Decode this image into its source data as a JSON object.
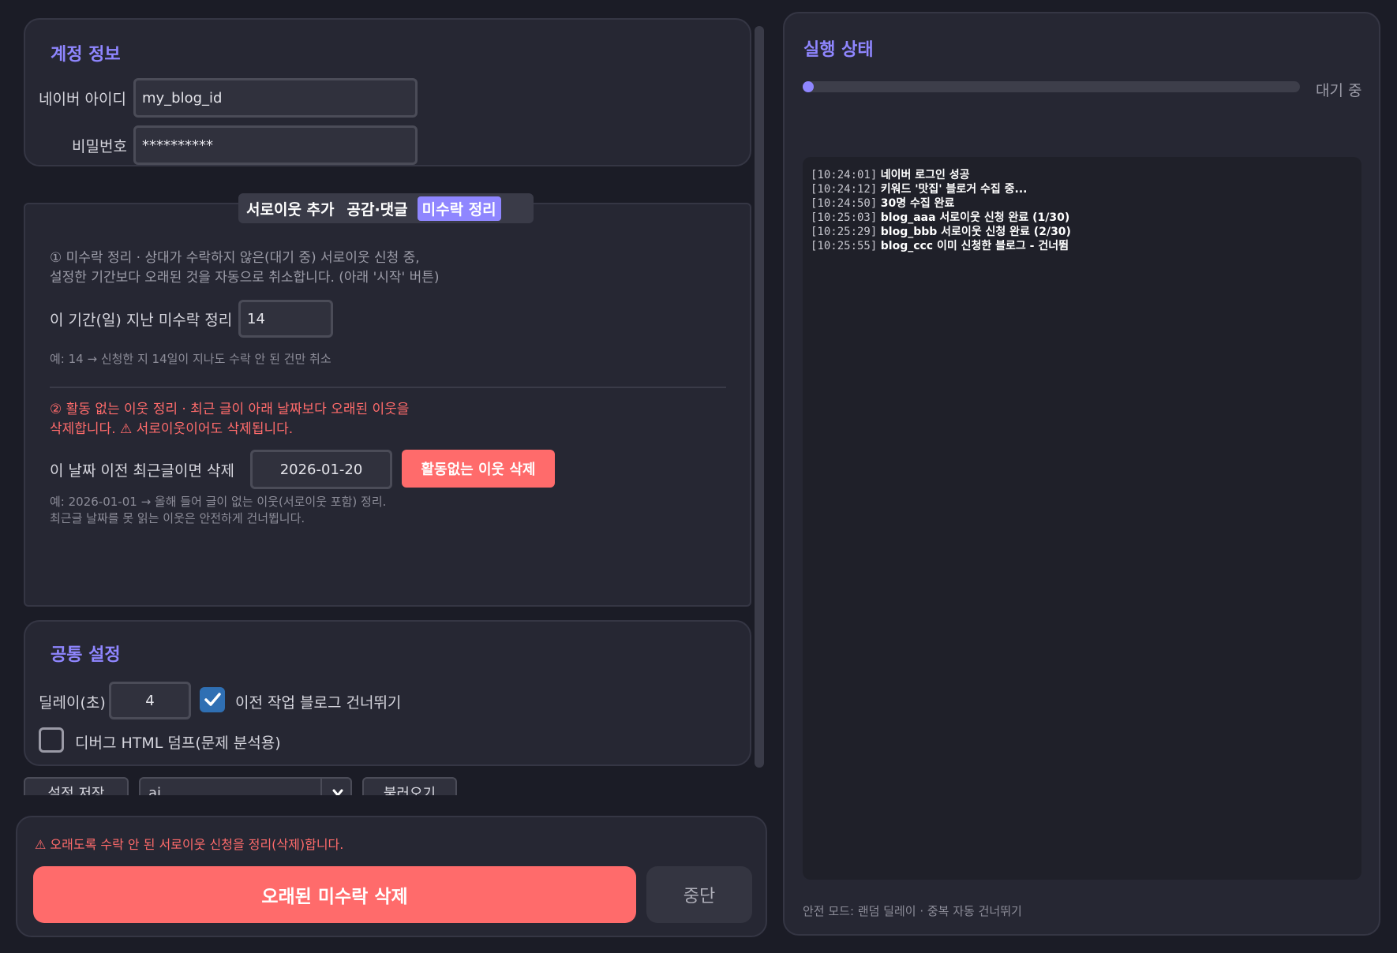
{
  "account": {
    "title": "계정 정보",
    "id_label": "네이버 아이디",
    "id_value": "my_blog_id",
    "pw_label": "비밀번호",
    "pw_value": "**********"
  },
  "tabs": [
    {
      "label": "서로이웃 추가",
      "active": false
    },
    {
      "label": "공감·댓글",
      "active": false
    },
    {
      "label": "미수락 정리",
      "active": true
    }
  ],
  "cleanup": {
    "intro_line1": "① 미수락 정리  ·  상대가 수락하지 않은(대기 중) 서로이웃 신청 중,",
    "intro_line2": "설정한 기간보다 오래된 것을 자동으로 취소합니다. (아래 '시작' 버튼)",
    "days_label": "이 기간(일) 지난 미수락 정리",
    "days_value": "14",
    "days_hint": "예: 14 → 신청한 지 14일이 지나도 수락 안 된 건만 취소",
    "inactive_line1": "② 활동 없는 이웃 정리  ·  최근 글이 아래 날짜보다 오래된 이웃을",
    "inactive_line2": "삭제합니다. ⚠ 서로이웃이어도 삭제됩니다.",
    "date_label": "이 날짜 이전 최근글이면 삭제",
    "date_value": "2026-01-20",
    "delete_inactive_button": "활동없는 이웃 삭제",
    "date_hint1": "예: 2026-01-01 → 올해 들어 글이 없는 이웃(서로이웃 포함) 정리.",
    "date_hint2": "최근글 날짜를 못 읽는 이웃은 안전하게 건너뜁니다."
  },
  "common": {
    "title": "공통 설정",
    "delay_label": "딜레이(초)",
    "delay_value": "4",
    "skip_label": "이전 작업 블로그 건너뛰기",
    "skip_checked": true,
    "debug_label": "디버그 HTML 덤프(문제 분석용)",
    "debug_checked": false
  },
  "settings_row": {
    "save_label": "설정 저장",
    "profile_value": "ai",
    "load_label": "불러오기"
  },
  "footer": {
    "warning": "⚠ 오래도록 수락 안 된 서로이웃 신청을 정리(삭제)합니다.",
    "primary_button": "오래된 미수락 삭제",
    "stop_button": "중단"
  },
  "status": {
    "title": "실행 상태",
    "progress": 0.0,
    "state_text": "대기 중",
    "log": [
      {
        "time": "[10:24:01]",
        "text": "네이버 로그인 성공"
      },
      {
        "time": "[10:24:12]",
        "text": "키워드 '맛집' 블로거 수집 중..."
      },
      {
        "time": "[10:24:50]",
        "text": "30명 수집 완료"
      },
      {
        "time": "[10:25:03]",
        "text": "blog_aaa 서로이웃 신청 완료 (1/30)"
      },
      {
        "time": "[10:25:29]",
        "text": "blog_bbb 서로이웃 신청 완료 (2/30)"
      },
      {
        "time": "[10:25:55]",
        "text": "blog_ccc 이미 신청한 블로그 - 건너뜀"
      }
    ],
    "footer_note": "안전 모드: 랜덤 딜레이 · 중복 자동 건너뛰기"
  },
  "colors": {
    "accent": "#8f86ff",
    "danger": "#ff6b6b",
    "background": "#1b1c26",
    "panel": "#262733",
    "checkbox_on": "#2f6fb3"
  }
}
